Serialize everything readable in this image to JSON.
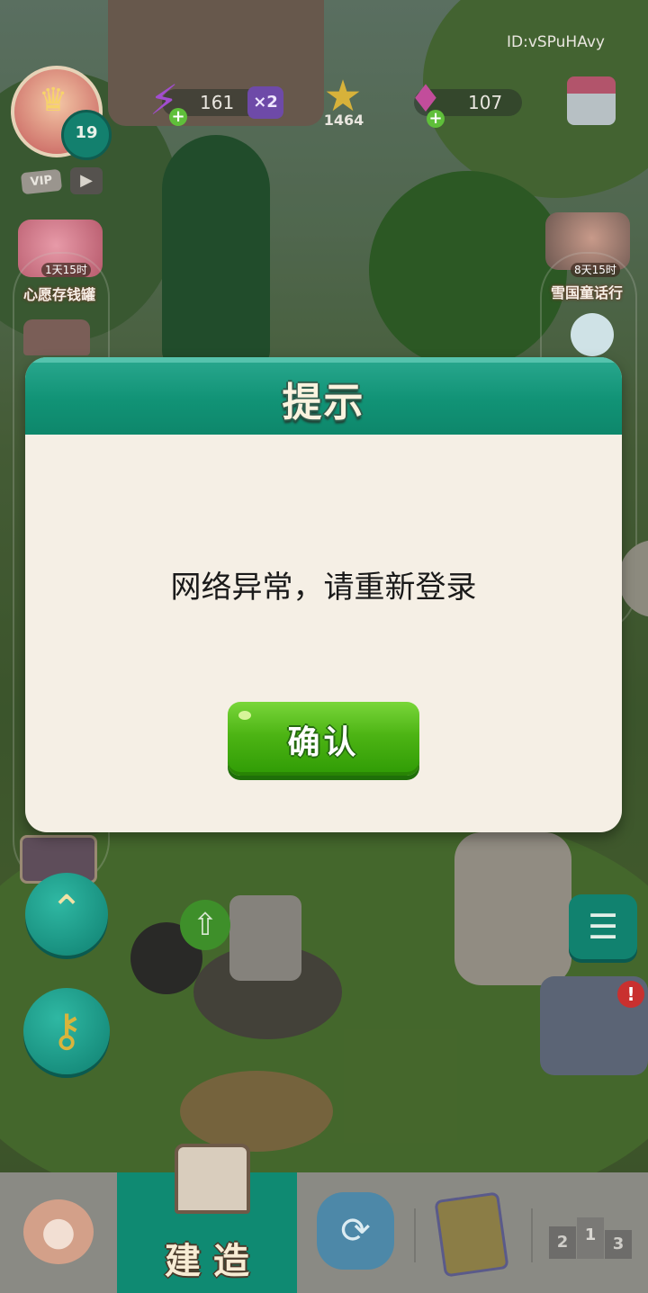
{
  "hud": {
    "player_id": "ID:vSPuHAvy",
    "level": "19",
    "vip_label": "VIP",
    "energy_value": "161",
    "energy_multiplier": "×2",
    "stars_value": "1464",
    "gems_value": "107"
  },
  "side_events": {
    "left": {
      "timer": "1天15时",
      "label": "心愿存钱罐"
    },
    "right": {
      "timer": "8天15时",
      "label": "雪国童话行"
    }
  },
  "dialog": {
    "title": "提示",
    "message": "网络异常，请重新登录",
    "confirm_label": "确认"
  },
  "bottom_nav": {
    "active_tab_label": "建 造",
    "podium_numbers": [
      "2",
      "1",
      "3"
    ]
  },
  "colors": {
    "dialog_header": "#119376",
    "dialog_body": "#f5efe5",
    "confirm_green": "#4db414",
    "bottom_active_tab": "#0f8a72"
  }
}
